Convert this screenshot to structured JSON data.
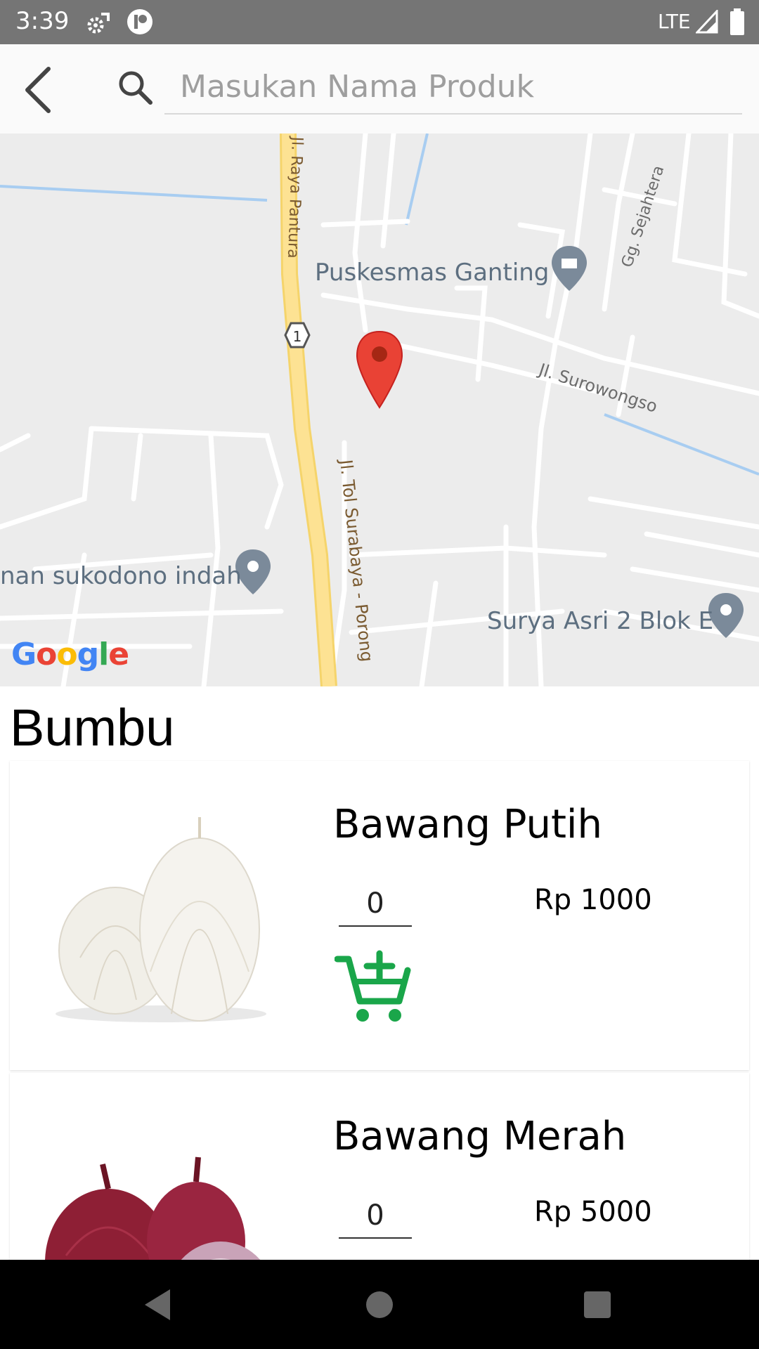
{
  "status_bar": {
    "time": "3:39",
    "network": "LTE",
    "icons": [
      "settings-sync-icon",
      "notification-badge-icon",
      "signal-icon",
      "battery-icon"
    ]
  },
  "toolbar": {
    "back_icon": "chevron-left-icon",
    "search_icon": "search-icon",
    "search_placeholder": "Masukan Nama Produk",
    "search_value": ""
  },
  "map": {
    "roads": [
      "Jl. Raya Pantura",
      "Jl. Tol Surabaya - Porong",
      "Jl. Surowongso",
      "Gg. Sejahtera"
    ],
    "route_shield": "1",
    "places": [
      "Puskesmas Ganting",
      "nan sukodono indah",
      "Surya Asri 2 Blok E"
    ],
    "attribution": "Google",
    "marker_color": "#e94235"
  },
  "category": {
    "title": "Bumbu"
  },
  "products": [
    {
      "name": "Bawang Putih",
      "quantity": "0",
      "price": "Rp 1000",
      "image_icon": "garlic-image"
    },
    {
      "name": "Bawang Merah",
      "quantity": "0",
      "price": "Rp 5000",
      "image_icon": "red-onion-image"
    }
  ],
  "colors": {
    "status_bar": "#757575",
    "accent_green": "#1aa64a",
    "map_road_major": "#fde293"
  },
  "nav_bar": {
    "icons": [
      "nav-back-icon",
      "nav-home-icon",
      "nav-recents-icon"
    ]
  }
}
